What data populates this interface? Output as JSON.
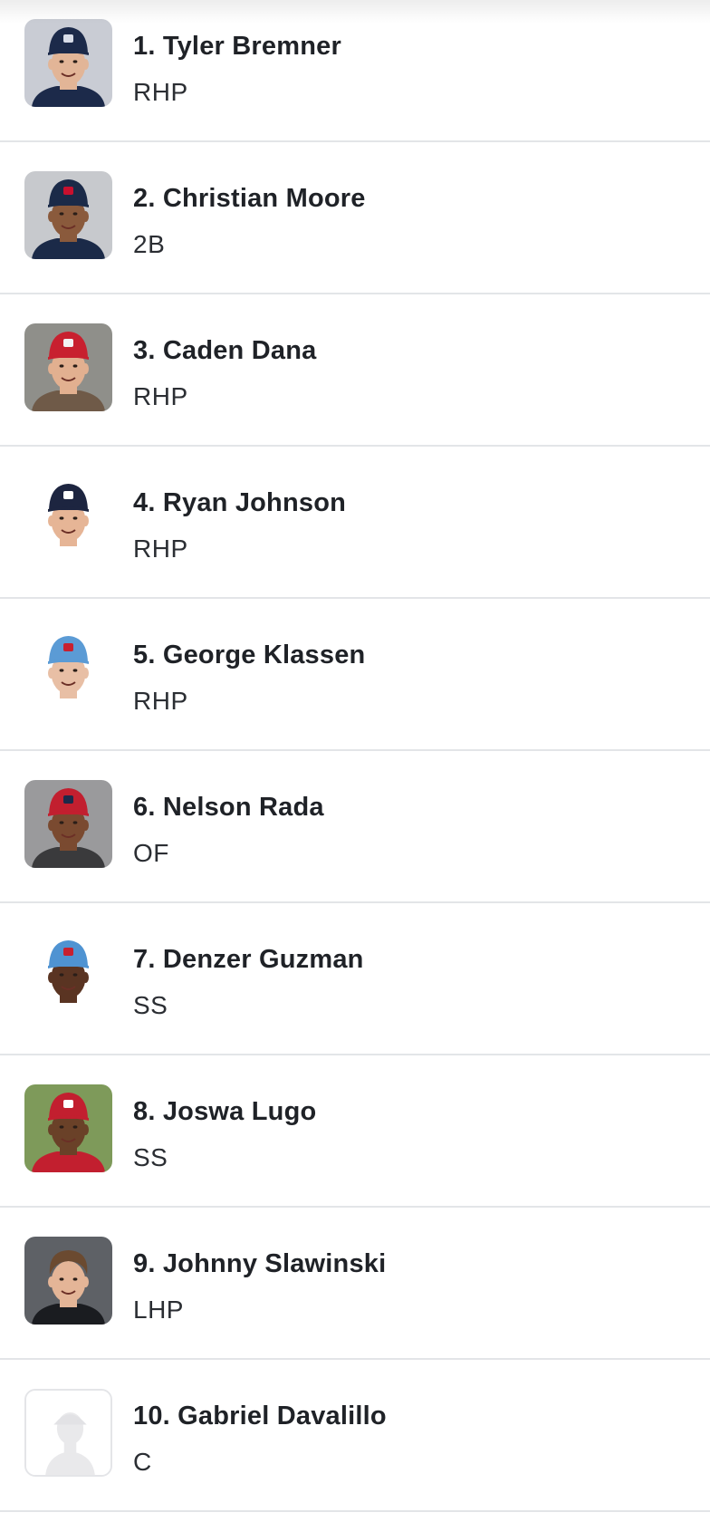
{
  "prospects": [
    {
      "name": "1. Tyler Bremner",
      "position": "RHP",
      "avatar": {
        "icon": "player-photo",
        "bg": "#c9ccd4",
        "cap": "#1c2a4a",
        "cap_logo": "#d8dde8",
        "skin": "#e2b597",
        "shirt": "#1c2a4a"
      }
    },
    {
      "name": "2. Christian Moore",
      "position": "2B",
      "avatar": {
        "icon": "player-photo",
        "bg": "#c7c9cd",
        "cap": "#1b2a48",
        "cap_logo": "#c8102e",
        "skin": "#8a5a3c",
        "shirt": "#1b2a48"
      }
    },
    {
      "name": "3. Caden Dana",
      "position": "RHP",
      "avatar": {
        "icon": "player-photo",
        "bg": "#8f8f8a",
        "cap": "#c8202f",
        "cap_logo": "#f2f2f2",
        "skin": "#e2b090",
        "shirt": "#6f5a48"
      }
    },
    {
      "name": "4. Ryan Johnson",
      "position": "RHP",
      "avatar": {
        "icon": "player-photo",
        "bg": "#ffffff",
        "cap": "#1d2540",
        "cap_logo": "#ffffff",
        "skin": "#e6b596",
        "shirt": "#ffffff"
      }
    },
    {
      "name": "5. George Klassen",
      "position": "RHP",
      "avatar": {
        "icon": "player-photo",
        "bg": "#ffffff",
        "cap": "#5b9bd5",
        "cap_logo": "#c8202f",
        "skin": "#e8bfa5",
        "shirt": "#ffffff"
      }
    },
    {
      "name": "6. Nelson Rada",
      "position": "OF",
      "avatar": {
        "icon": "player-photo",
        "bg": "#9a9a9c",
        "cap": "#c21f2f",
        "cap_logo": "#1c2a4a",
        "skin": "#7a4a30",
        "shirt": "#3a3a3c"
      }
    },
    {
      "name": "7. Denzer Guzman",
      "position": "SS",
      "avatar": {
        "icon": "player-photo",
        "bg": "#ffffff",
        "cap": "#4f93d2",
        "cap_logo": "#c8202f",
        "skin": "#5a3422",
        "shirt": "#ffffff"
      }
    },
    {
      "name": "8. Joswa Lugo",
      "position": "SS",
      "avatar": {
        "icon": "player-photo",
        "bg": "#7e9a5a",
        "cap": "#c21f2f",
        "cap_logo": "#ffffff",
        "skin": "#6a4128",
        "shirt": "#c21f2f"
      }
    },
    {
      "name": "9. Johnny Slawinski",
      "position": "LHP",
      "avatar": {
        "icon": "player-photo",
        "bg": "#5e6166",
        "cap": null,
        "cap_logo": null,
        "skin": "#e4b597",
        "shirt": "#1a1c20"
      }
    },
    {
      "name": "10. Gabriel Davalillo",
      "position": "C",
      "avatar": {
        "icon": "placeholder-silhouette-icon",
        "bg": "#ffffff",
        "cap": null,
        "cap_logo": null,
        "skin": "#e9e9eb",
        "shirt": "#e9e9eb"
      }
    }
  ]
}
